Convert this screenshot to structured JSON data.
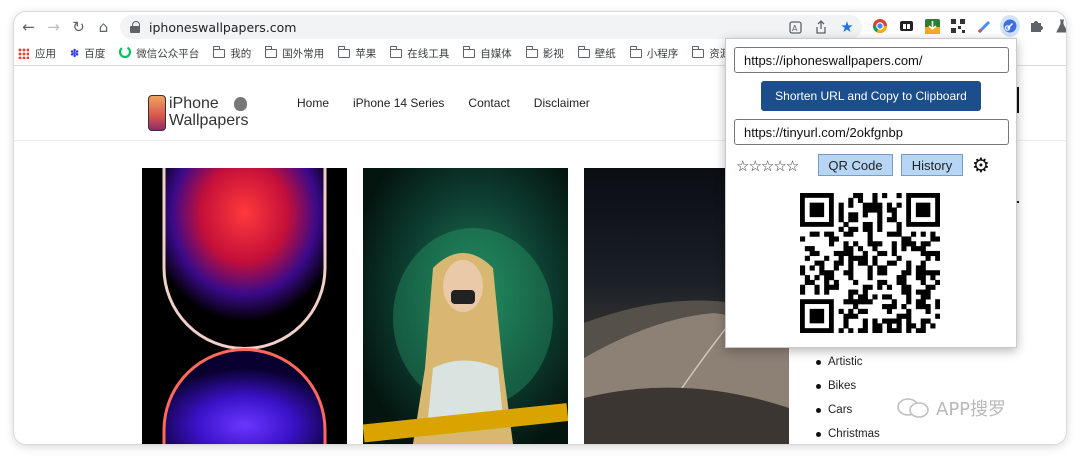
{
  "browser": {
    "url": "iphoneswallpapers.com",
    "nav_icons": [
      "back-icon",
      "forward-icon",
      "reload-icon",
      "home-icon"
    ]
  },
  "bookmarks": [
    {
      "label": "应用",
      "icon": "apps-grid-icon"
    },
    {
      "label": "百度",
      "icon": "baidu-paw-icon"
    },
    {
      "label": "微信公众平台",
      "icon": "wechat-icon"
    },
    {
      "label": "我的",
      "icon": "folder-icon"
    },
    {
      "label": "国外常用",
      "icon": "folder-icon"
    },
    {
      "label": "苹果",
      "icon": "folder-icon"
    },
    {
      "label": "在线工具",
      "icon": "folder-icon"
    },
    {
      "label": "自媒体",
      "icon": "folder-icon"
    },
    {
      "label": "影视",
      "icon": "folder-icon"
    },
    {
      "label": "壁纸",
      "icon": "folder-icon"
    },
    {
      "label": "小程序",
      "icon": "folder-icon"
    },
    {
      "label": "资源",
      "icon": "folder-icon"
    }
  ],
  "site": {
    "logo_line1": "iPhone",
    "logo_line2": "Wallpapers",
    "nav": [
      "Home",
      "iPhone 14 Series",
      "Contact",
      "Disclaimer"
    ],
    "categories": [
      "Artistic",
      "Bikes",
      "Cars",
      "Christmas"
    ]
  },
  "popup": {
    "long_url": "https://iphoneswallpapers.com/",
    "shorten_label": "Shorten URL and Copy to Clipboard",
    "short_url": "https://tinyurl.com/2okfgnbp",
    "stars": "☆☆☆☆☆",
    "qr_label": "QR Code",
    "history_label": "History"
  },
  "watermark": "APP搜罗",
  "colors": {
    "accent": "#1c4e8c",
    "button_light": "#b7d6f5"
  }
}
